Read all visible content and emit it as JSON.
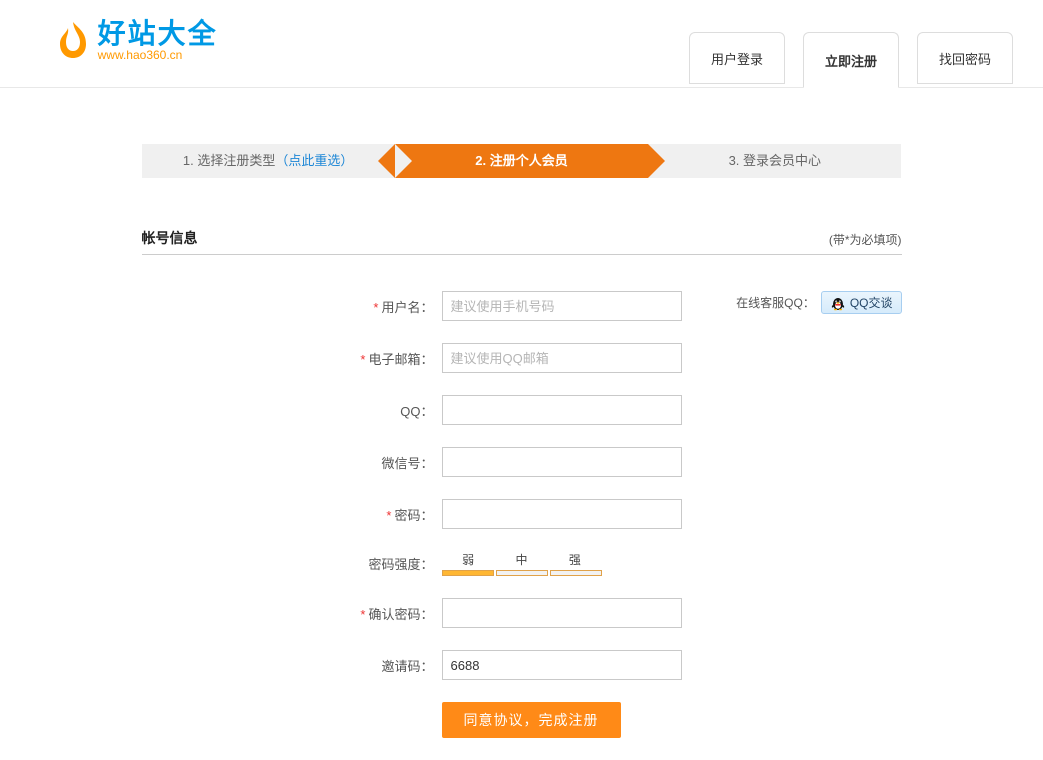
{
  "logo": {
    "main": "好站大全",
    "sub": "www.hao360.cn"
  },
  "tabs": {
    "login": "用户登录",
    "register": "立即注册",
    "recover": "找回密码"
  },
  "steps": {
    "s1_prefix": "1. 选择注册类型",
    "s1_link": "（点此重选）",
    "s2": "2. 注册个人会员",
    "s3": "3. 登录会员中心"
  },
  "section": {
    "title": "帐号信息",
    "note": "(带*为必填项)"
  },
  "support": {
    "label": "在线客服QQ：",
    "button": "QQ交谈"
  },
  "form": {
    "username": {
      "label": "用户名：",
      "placeholder": "建议使用手机号码",
      "required": true
    },
    "email": {
      "label": "电子邮箱：",
      "placeholder": "建议使用QQ邮箱",
      "required": true
    },
    "qq": {
      "label": "QQ：",
      "required": false
    },
    "wechat": {
      "label": "微信号：",
      "required": false
    },
    "password": {
      "label": "密码：",
      "required": true
    },
    "strength": {
      "label": "密码强度：",
      "levels": {
        "weak": "弱",
        "mid": "中",
        "strong": "强"
      }
    },
    "confirm": {
      "label": "确认密码：",
      "required": true
    },
    "invite": {
      "label": "邀请码：",
      "value": "6688",
      "required": false
    },
    "submit": "同意协议，完成注册"
  }
}
